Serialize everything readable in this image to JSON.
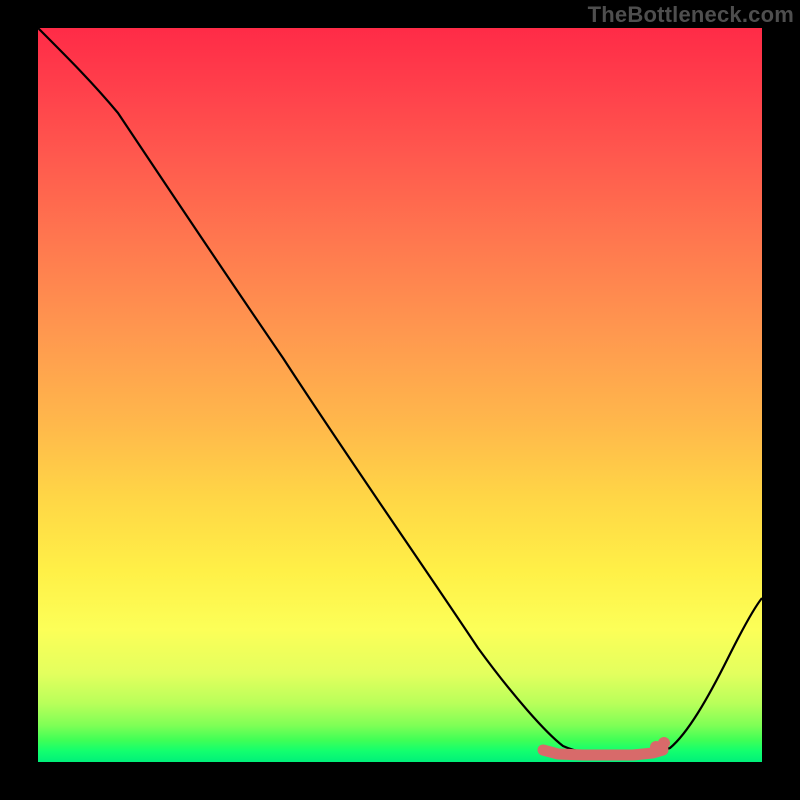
{
  "watermark": "TheBottleneck.com",
  "chart_data": {
    "type": "line",
    "title": "",
    "xlabel": "",
    "ylabel": "",
    "xlim": [
      0,
      100
    ],
    "ylim": [
      0,
      100
    ],
    "grid": false,
    "legend": false,
    "series": [
      {
        "name": "curve",
        "x": [
          0,
          5,
          10,
          15,
          20,
          25,
          30,
          35,
          40,
          45,
          50,
          55,
          60,
          65,
          70,
          72,
          75,
          78,
          82,
          86,
          90,
          94,
          97,
          100
        ],
        "values": [
          100,
          96,
          92,
          86,
          78,
          69,
          61,
          52,
          44,
          36,
          28,
          20,
          13,
          7,
          2.5,
          1.5,
          1.2,
          1.2,
          1.4,
          1.6,
          4,
          9,
          15.5,
          22
        ]
      }
    ],
    "annotations": {
      "optimal_range_x": [
        70,
        86
      ],
      "optimal_range_y_approx": 1.5,
      "marker_dots_x": [
        85,
        86
      ],
      "marker_color": "#d86a6a"
    },
    "colors": {
      "gradient_top": "#ff2b47",
      "gradient_mid": "#ffd646",
      "gradient_bottom": "#00f07a",
      "curve": "#000000",
      "background_frame": "#000000"
    }
  }
}
